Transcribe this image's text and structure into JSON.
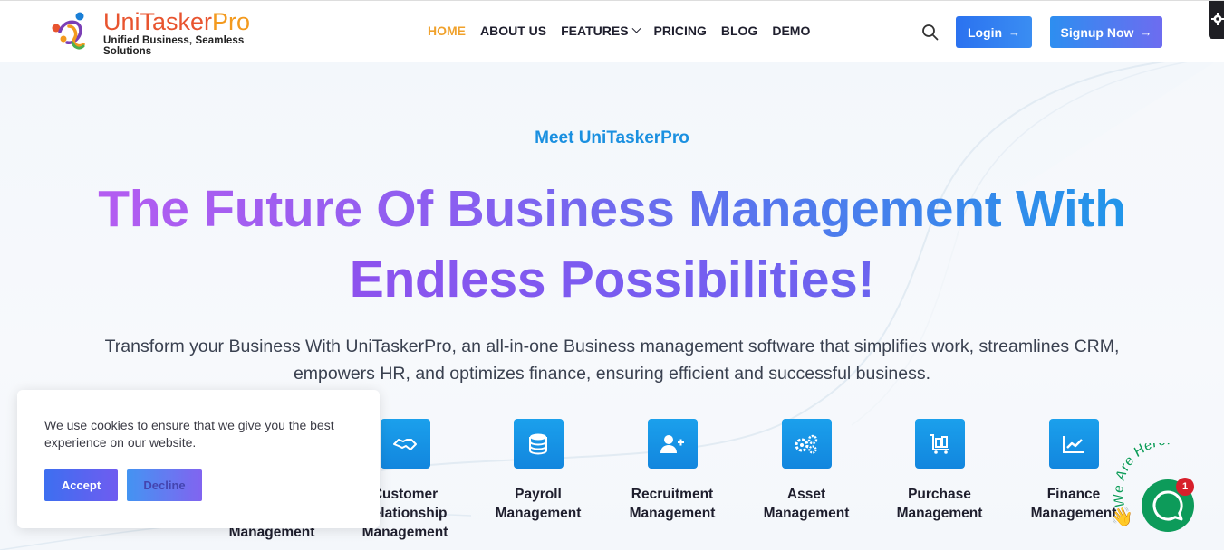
{
  "brand": {
    "name_part1": "Uni",
    "name_part2": "Tasker",
    "name_part3": "Pro",
    "tagline": "Unified Business, Seamless Solutions"
  },
  "nav": {
    "items": [
      {
        "label": "HOME",
        "active": true
      },
      {
        "label": "ABOUT US"
      },
      {
        "label": "FEATURES",
        "has_dropdown": true
      },
      {
        "label": "PRICING"
      },
      {
        "label": "BLOG"
      },
      {
        "label": "DEMO"
      }
    ],
    "login_label": "Login",
    "signup_label": "Signup Now",
    "arrow": "→"
  },
  "hero": {
    "eyebrow": "Meet UniTaskerPro",
    "headline_line1": "The Future Of Business Management With",
    "headline_line2": "Endless Possibilities!",
    "subtext": "Transform your Business With UniTaskerPro, an all-in-one Business management software that simplifies work, streamlines CRM, empowers HR, and optimizes finance, ensuring efficient and successful business."
  },
  "features": [
    {
      "label_line1": "",
      "label_line2": "Management",
      "icon": "project-icon"
    },
    {
      "label_line1": "Customer",
      "label_line2": "Relationship",
      "label_line3": "Management",
      "icon": "handshake-icon"
    },
    {
      "label_line1": "Payroll",
      "label_line2": "Management",
      "icon": "coins-icon"
    },
    {
      "label_line1": "Recruitment",
      "label_line2": "Management",
      "icon": "add-user-icon"
    },
    {
      "label_line1": "Asset",
      "label_line2": "Management",
      "icon": "gears-icon"
    },
    {
      "label_line1": "Purchase",
      "label_line2": "Management",
      "icon": "cart-icon"
    },
    {
      "label_line1": "Finance",
      "label_line2": "Management",
      "icon": "chart-line-icon"
    }
  ],
  "cookie": {
    "message": "We use cookies to ensure that we give you the best experience on our website.",
    "accept_label": "Accept",
    "decline_label": "Decline"
  },
  "chat": {
    "arc_text": "We Are Here!",
    "badge_count": "1"
  },
  "colors": {
    "accent_orange": "#f0a12b",
    "accent_blue": "#1a90e0",
    "gradient_purple": "#b45df1",
    "chat_green": "#0d9b5a"
  }
}
